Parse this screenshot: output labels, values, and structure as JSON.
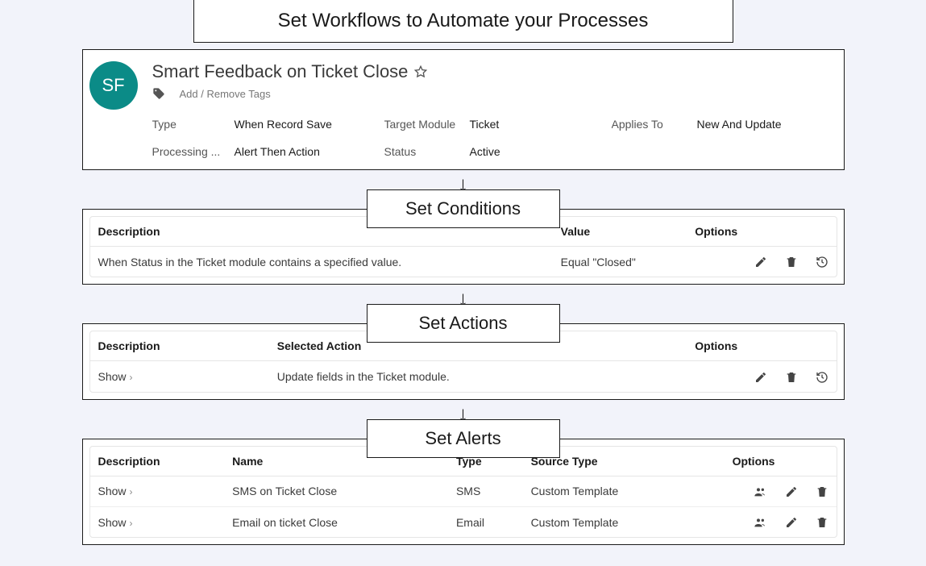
{
  "header": {
    "title": "Set Workflows to Automate your Processes"
  },
  "workflow": {
    "avatar": "SF",
    "title": "Smart Feedback on Ticket Close",
    "tags_link": "Add / Remove Tags",
    "fields": {
      "type_label": "Type",
      "type_value": "When Record Save",
      "target_module_label": "Target Module",
      "target_module_value": "Ticket",
      "applies_to_label": "Applies To",
      "applies_to_value": "New And Update",
      "processing_label": "Processing ...",
      "processing_value": "Alert Then Action",
      "status_label": "Status",
      "status_value": "Active"
    }
  },
  "conditions": {
    "section_title": "Set Conditions",
    "headers": {
      "description": "Description",
      "value": "Value",
      "options": "Options"
    },
    "rows": [
      {
        "description": "When Status in the Ticket module contains a specified value.",
        "value": "Equal \"Closed\""
      }
    ]
  },
  "actions": {
    "section_title": "Set Actions",
    "headers": {
      "description": "Description",
      "selected_action": "Selected Action",
      "options": "Options"
    },
    "rows": [
      {
        "show": "Show",
        "selected_action": "Update fields in the Ticket module."
      }
    ]
  },
  "alerts": {
    "section_title": "Set Alerts",
    "headers": {
      "description": "Description",
      "name": "Name",
      "type": "Type",
      "source_type": "Source Type",
      "options": "Options"
    },
    "rows": [
      {
        "show": "Show",
        "name": "SMS on Ticket Close",
        "type": "SMS",
        "source_type": "Custom Template"
      },
      {
        "show": "Show",
        "name": "Email on ticket Close",
        "type": "Email",
        "source_type": "Custom Template"
      }
    ]
  }
}
